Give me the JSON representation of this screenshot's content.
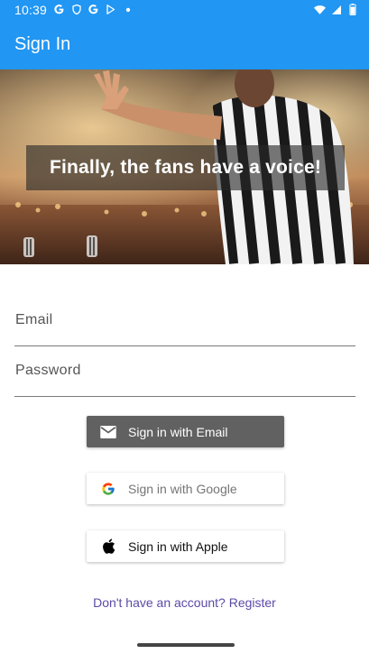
{
  "status_bar": {
    "time": "10:39",
    "icons": [
      "google-g-icon",
      "shield-icon",
      "google-g-icon",
      "play-store-icon",
      "dot-icon"
    ],
    "right_icons": [
      "wifi-icon",
      "signal-icon",
      "battery-icon"
    ]
  },
  "app_bar": {
    "title": "Sign In"
  },
  "hero": {
    "banner_text": "Finally, the fans have a voice!"
  },
  "form": {
    "email_label": "Email",
    "password_label": "Password"
  },
  "buttons": {
    "email": {
      "label": "Sign in with Email",
      "icon": "mail-icon"
    },
    "google": {
      "label": "Sign in with Google",
      "icon": "google-logo-icon"
    },
    "apple": {
      "label": "Sign in with Apple",
      "icon": "apple-logo-icon"
    }
  },
  "register": {
    "label": "Don't have an account? Register"
  },
  "colors": {
    "primary": "#2196f3",
    "email_button": "#616161",
    "link": "#5b4aa6"
  }
}
